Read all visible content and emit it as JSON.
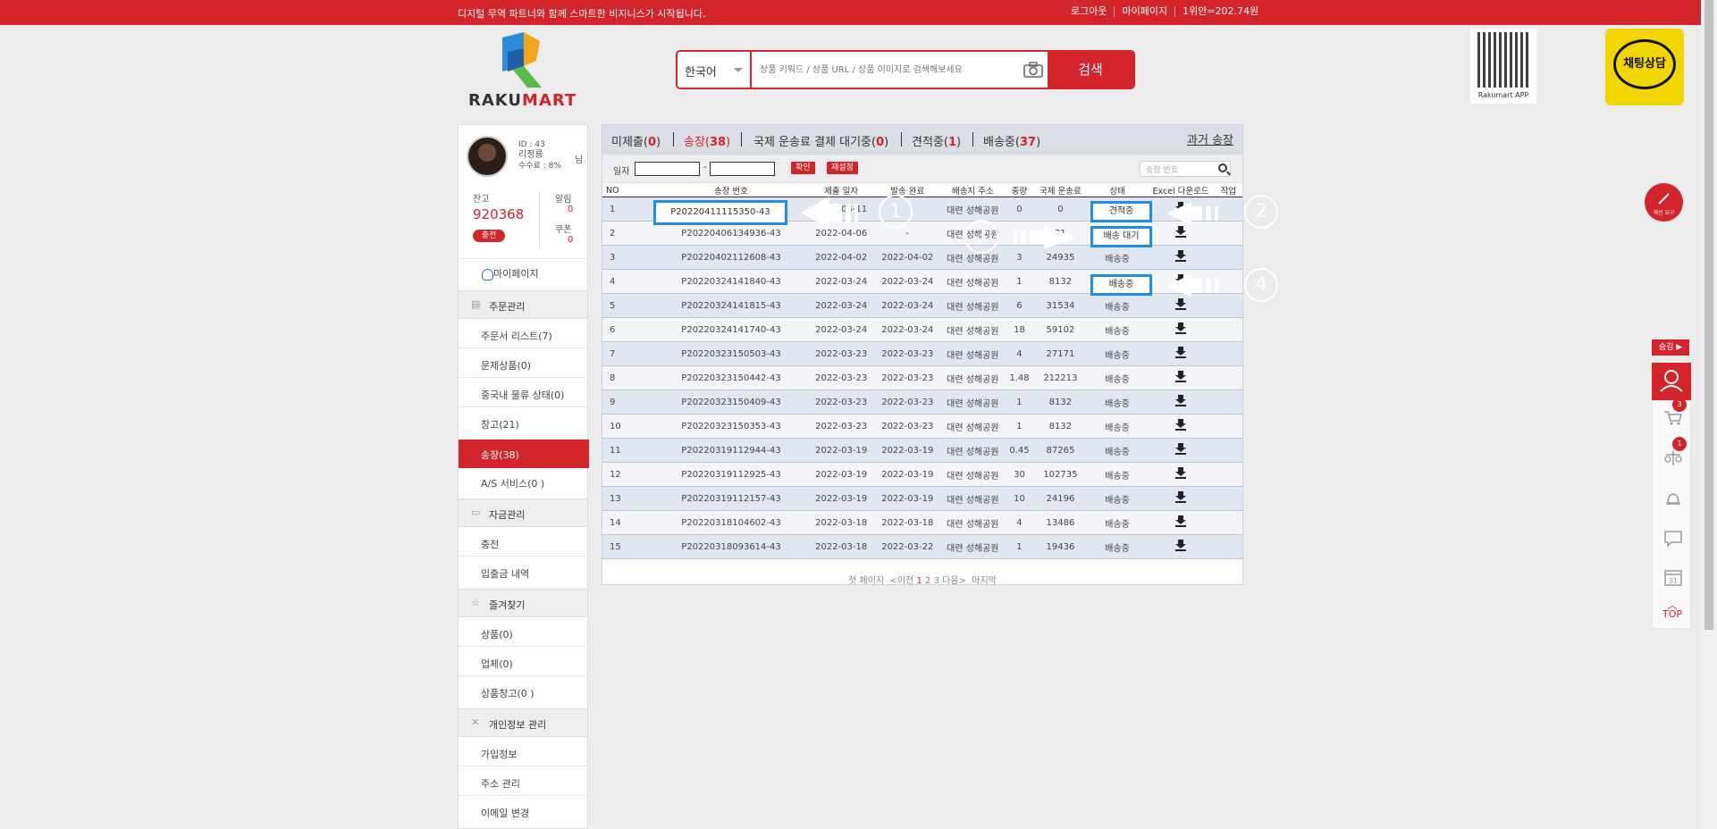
{
  "topbar": {
    "message": "디지털 무역 파트너와 함께 스마트한 비지니스가 시작됩니다.",
    "links": [
      "로그아웃",
      "마이페이지",
      "1위안=202.74원"
    ]
  },
  "header": {
    "logo_text_a": "RAKU",
    "logo_text_b": "MART",
    "lang": "한국어",
    "search_placeholder": "상품 키워드 / 상품 URL / 상품 이미지로 검색해보세요",
    "search_button": "검색",
    "qr_caption": "Rakumart APP",
    "chat_label": "채팅상담"
  },
  "sidebar": {
    "id": "ID : 43",
    "name": "리정룡",
    "name_suffix": "님",
    "fee": "수수료 : 8%",
    "balance_label": "잔고",
    "balance": "920368",
    "charge": "충전",
    "notice_label": "알림",
    "notice_count": "0",
    "coupon_label": "쿠폰",
    "coupon_count": "0",
    "mypage": "마이페이지",
    "sections": {
      "orders": "주문관리",
      "funds": "자금관리",
      "favorites": "즐겨찾기",
      "personal": "개인정보 관리"
    },
    "items": {
      "order_list": "주문서 리스트(7)",
      "problem": "문제상품(0)",
      "logistics": "중국내 물류 상태(0)",
      "warehouse": "창고(21)",
      "invoice": "송장(38)",
      "as": "A/S 서비스(0 )",
      "charge": "충전",
      "history": "입출금 내역",
      "fav_products": "상품(0)",
      "fav_shops": "업체(0)",
      "fav_warehouse": "상품창고(0 )",
      "join_info": "가입정보",
      "address": "주소 관리",
      "email": "이메일 변경"
    }
  },
  "tabs": [
    {
      "label": "미제출",
      "count": "0"
    },
    {
      "label": "송장",
      "count": "38"
    },
    {
      "label": "국제 운송료 결제 대기중",
      "count": "0"
    },
    {
      "label": "견적중",
      "count": "1"
    },
    {
      "label": "배송중",
      "count": "37"
    }
  ],
  "past_invoice": "과거 송장",
  "filter": {
    "date_label": "일자",
    "dash": "-",
    "confirm": "확인",
    "reset": "재설정",
    "search_placeholder": "송장 번호"
  },
  "table": {
    "headers": [
      "NO",
      "송장 번호",
      "제출 일자",
      "발송 완료",
      "배송지 주소",
      "중량",
      "국제 운송료",
      "상태",
      "Excel 다운로드",
      "작업"
    ],
    "rows": [
      {
        "no": "1",
        "invoice": "P20220411115350-43",
        "submit": "2022-04-11",
        "sent": "",
        "address": "대련 성해공원",
        "weight": "0",
        "fee": "0",
        "status": "견적중"
      },
      {
        "no": "2",
        "invoice": "P20220406134936-43",
        "submit": "2022-04-06",
        "sent": "-",
        "address": "대련 성해공원",
        "weight": "",
        "fee": "21",
        "status": "배송 대기"
      },
      {
        "no": "3",
        "invoice": "P20220402112608-43",
        "submit": "2022-04-02",
        "sent": "2022-04-02",
        "address": "대련 성해공원",
        "weight": "3",
        "fee": "24935",
        "status": "배송중"
      },
      {
        "no": "4",
        "invoice": "P20220324141840-43",
        "submit": "2022-03-24",
        "sent": "2022-03-24",
        "address": "대련 성해공원",
        "weight": "1",
        "fee": "8132",
        "status": "배송중"
      },
      {
        "no": "5",
        "invoice": "P20220324141815-43",
        "submit": "2022-03-24",
        "sent": "2022-03-24",
        "address": "대련 성해공원",
        "weight": "6",
        "fee": "31534",
        "status": "배송중"
      },
      {
        "no": "6",
        "invoice": "P20220324141740-43",
        "submit": "2022-03-24",
        "sent": "2022-03-24",
        "address": "대련 성해공원",
        "weight": "18",
        "fee": "59102",
        "status": "배송중"
      },
      {
        "no": "7",
        "invoice": "P20220323150503-43",
        "submit": "2022-03-23",
        "sent": "2022-03-23",
        "address": "대련 성해공원",
        "weight": "4",
        "fee": "27171",
        "status": "배송중"
      },
      {
        "no": "8",
        "invoice": "P20220323150442-43",
        "submit": "2022-03-23",
        "sent": "2022-03-23",
        "address": "대련 성해공원",
        "weight": "1.48",
        "fee": "212213",
        "status": "배송중"
      },
      {
        "no": "9",
        "invoice": "P20220323150409-43",
        "submit": "2022-03-23",
        "sent": "2022-03-23",
        "address": "대련 성해공원",
        "weight": "1",
        "fee": "8132",
        "status": "배송중"
      },
      {
        "no": "10",
        "invoice": "P20220323150353-43",
        "submit": "2022-03-23",
        "sent": "2022-03-23",
        "address": "대련 성해공원",
        "weight": "1",
        "fee": "8132",
        "status": "배송중"
      },
      {
        "no": "11",
        "invoice": "P20220319112944-43",
        "submit": "2022-03-19",
        "sent": "2022-03-19",
        "address": "대련 성해공원",
        "weight": "0.45",
        "fee": "87265",
        "status": "배송중"
      },
      {
        "no": "12",
        "invoice": "P20220319112925-43",
        "submit": "2022-03-19",
        "sent": "2022-03-19",
        "address": "대련 성해공원",
        "weight": "30",
        "fee": "102735",
        "status": "배송중"
      },
      {
        "no": "13",
        "invoice": "P20220319112157-43",
        "submit": "2022-03-19",
        "sent": "2022-03-19",
        "address": "대련 성해공원",
        "weight": "10",
        "fee": "24196",
        "status": "배송중"
      },
      {
        "no": "14",
        "invoice": "P20220318104602-43",
        "submit": "2022-03-18",
        "sent": "2022-03-18",
        "address": "대련 성해공원",
        "weight": "4",
        "fee": "13486",
        "status": "배송중"
      },
      {
        "no": "15",
        "invoice": "P20220318093614-43",
        "submit": "2022-03-18",
        "sent": "2022-03-22",
        "address": "대련 성해공원",
        "weight": "1",
        "fee": "19436",
        "status": "배송중"
      }
    ]
  },
  "pager": {
    "first": "첫 페이지",
    "prev": "<이전",
    "p1": "1",
    "p2": "2",
    "p3": "3",
    "next": "다음>",
    "last": "마지막"
  },
  "annotations": {
    "c1": "1",
    "c2": "2",
    "c3": "3",
    "c4": "4"
  },
  "highlights": {
    "invoice": "P20220411115350-43",
    "status1": "견적중",
    "status2": "배송 대기",
    "status4": "배송중"
  },
  "right_rail": {
    "hide": "숨김 ▶",
    "cart_badge": "3",
    "fav_badge": "1",
    "pen_label": "개선 요구",
    "top": "TOP",
    "cal": "31"
  },
  "colors": {
    "brand": "#d2242a",
    "highlight": "#1e8fe8",
    "chat_bg": "#f2d600"
  }
}
